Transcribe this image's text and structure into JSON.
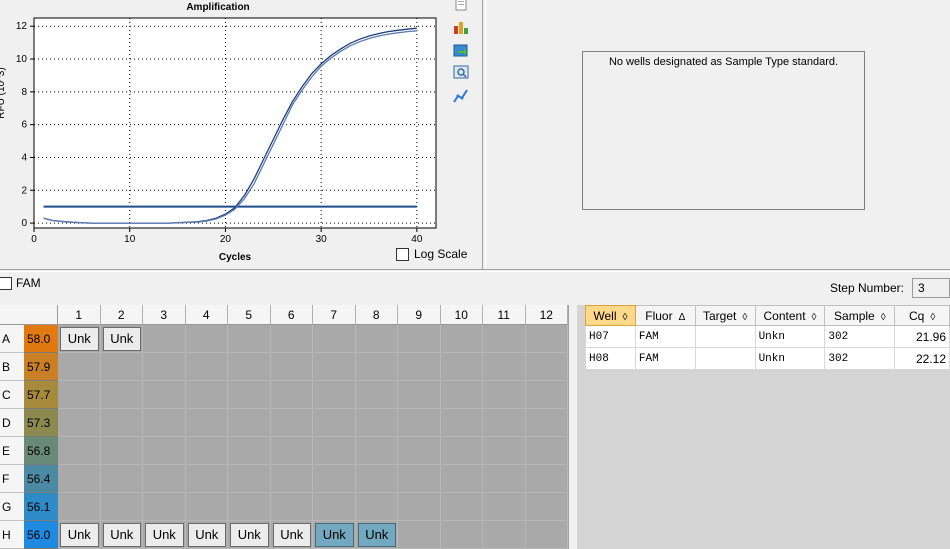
{
  "chart_data": {
    "type": "line",
    "title": "Amplification",
    "xlabel": "Cycles",
    "ylabel": "RFU (10^3)",
    "xlim": [
      0,
      42
    ],
    "ylim": [
      -0.3,
      12.5
    ],
    "xticks": [
      0,
      10,
      20,
      30,
      40
    ],
    "yticks": [
      0,
      2,
      4,
      6,
      8,
      10,
      12
    ],
    "grid": true,
    "threshold": 1.0,
    "series": [
      {
        "well": "H07",
        "x": [
          1,
          2,
          4,
          6,
          8,
          10,
          12,
          14,
          16,
          17,
          18,
          19,
          20,
          21,
          22,
          23,
          24,
          25,
          26,
          27,
          28,
          29,
          30,
          31,
          32,
          33,
          34,
          35,
          36,
          37,
          38,
          39,
          40
        ],
        "y": [
          0.3,
          0.15,
          0.05,
          0.0,
          0.0,
          0.0,
          0.0,
          0.0,
          0.05,
          0.08,
          0.15,
          0.3,
          0.55,
          0.95,
          1.7,
          2.7,
          3.9,
          5.1,
          6.3,
          7.4,
          8.3,
          9.1,
          9.7,
          10.2,
          10.6,
          10.95,
          11.2,
          11.4,
          11.55,
          11.67,
          11.75,
          11.82,
          11.88
        ]
      },
      {
        "well": "H08",
        "x": [
          1,
          2,
          4,
          6,
          8,
          10,
          12,
          14,
          16,
          17,
          18,
          19,
          20,
          21,
          22,
          23,
          24,
          25,
          26,
          27,
          28,
          29,
          30,
          31,
          32,
          33,
          34,
          35,
          36,
          37,
          38,
          39,
          40
        ],
        "y": [
          0.3,
          0.15,
          0.05,
          0.0,
          0.0,
          0.0,
          0.0,
          0.0,
          0.04,
          0.06,
          0.12,
          0.25,
          0.48,
          0.85,
          1.5,
          2.4,
          3.6,
          4.8,
          6.0,
          7.2,
          8.1,
          8.9,
          9.55,
          10.05,
          10.45,
          10.8,
          11.05,
          11.25,
          11.4,
          11.52,
          11.6,
          11.67,
          11.72
        ]
      }
    ]
  },
  "amplification": {
    "log_scale_label": "Log Scale",
    "log_scale_checked": false,
    "tools": [
      "copy-icon",
      "chart-options-icon",
      "export-icon",
      "zoom-icon",
      "trace-icon"
    ]
  },
  "standard_curve": {
    "message": "No wells designated as Sample Type standard."
  },
  "fluor_selector": {
    "label": "FAM",
    "checked": false
  },
  "step": {
    "label": "Step Number:",
    "value": "3"
  },
  "plate": {
    "columns": [
      "1",
      "2",
      "3",
      "4",
      "5",
      "6",
      "7",
      "8",
      "9",
      "10",
      "11",
      "12"
    ],
    "rows": [
      {
        "label": "A",
        "temp": "58.0",
        "color": "#e07a10"
      },
      {
        "label": "B",
        "temp": "57.9",
        "color": "#c98024"
      },
      {
        "label": "C",
        "temp": "57.7",
        "color": "#a88a3c"
      },
      {
        "label": "D",
        "temp": "57.3",
        "color": "#8c8a50"
      },
      {
        "label": "E",
        "temp": "56.8",
        "color": "#6a8a78"
      },
      {
        "label": "F",
        "temp": "56.4",
        "color": "#4b8aa2"
      },
      {
        "label": "G",
        "temp": "56.1",
        "color": "#2f8bc7"
      },
      {
        "label": "H",
        "temp": "56.0",
        "color": "#1f8ae0"
      }
    ],
    "wells": [
      {
        "row": 0,
        "col": 0,
        "label": "Unk",
        "selected": false
      },
      {
        "row": 0,
        "col": 1,
        "label": "Unk",
        "selected": false
      },
      {
        "row": 7,
        "col": 0,
        "label": "Unk",
        "selected": false
      },
      {
        "row": 7,
        "col": 1,
        "label": "Unk",
        "selected": false
      },
      {
        "row": 7,
        "col": 2,
        "label": "Unk",
        "selected": false
      },
      {
        "row": 7,
        "col": 3,
        "label": "Unk",
        "selected": false
      },
      {
        "row": 7,
        "col": 4,
        "label": "Unk",
        "selected": false
      },
      {
        "row": 7,
        "col": 5,
        "label": "Unk",
        "selected": false
      },
      {
        "row": 7,
        "col": 6,
        "label": "Unk",
        "selected": true
      },
      {
        "row": 7,
        "col": 7,
        "label": "Unk",
        "selected": true
      }
    ]
  },
  "well_table": {
    "headers": [
      "Well",
      "Fluor",
      "Target",
      "Content",
      "Sample",
      "Cq"
    ],
    "sort_glyphs": [
      "◊",
      "Δ",
      "◊",
      "◊",
      "◊",
      "◊"
    ],
    "rows": [
      [
        "H07",
        "FAM",
        "",
        "Unkn",
        "302",
        "21.96"
      ],
      [
        "H08",
        "FAM",
        "",
        "Unkn",
        "302",
        "22.12"
      ]
    ]
  }
}
